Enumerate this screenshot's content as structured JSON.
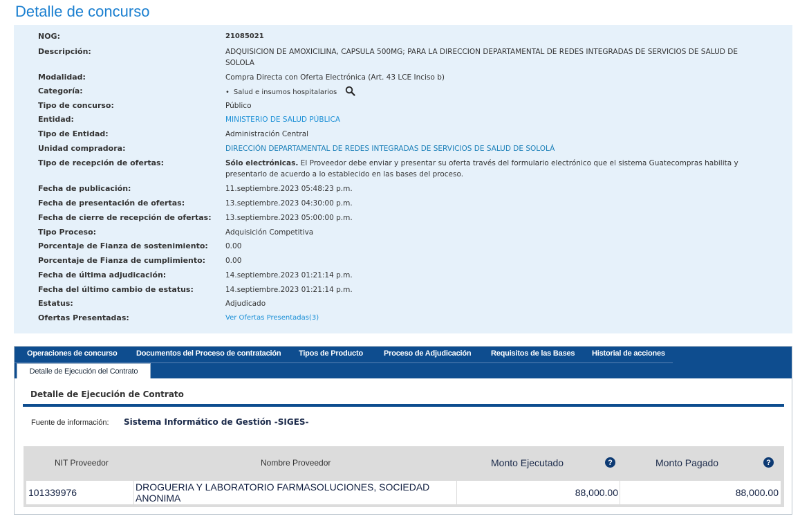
{
  "page": {
    "title": "Detalle de concurso"
  },
  "details": {
    "nog": {
      "label": "NOG:",
      "value": "21085021"
    },
    "descripcion": {
      "label": "Descripción:",
      "value": "ADQUISICION DE AMOXICILINA, CAPSULA 500MG; PARA LA DIRECCION DEPARTAMENTAL DE REDES INTEGRADAS DE SERVICIOS DE SALUD DE SOLOLA"
    },
    "modalidad": {
      "label": "Modalidad:",
      "value": "Compra Directa con Oferta Electrónica (Art. 43 LCE Inciso b)"
    },
    "categoria": {
      "label": "Categoría:",
      "bullet": "•",
      "value": "Salud e insumos hospitalarios",
      "icon": "search-icon"
    },
    "tipo_concurso": {
      "label": "Tipo de concurso:",
      "value": "Público"
    },
    "entidad": {
      "label": "Entidad:",
      "value": "MINISTERIO DE SALUD PÚBLICA"
    },
    "tipo_entidad": {
      "label": "Tipo de Entidad:",
      "value": "Administración Central"
    },
    "unidad_compradora": {
      "label": "Unidad compradora:",
      "value": "DIRECCIÓN DEPARTAMENTAL DE REDES INTEGRADAS DE SERVICIOS DE SALUD DE SOLOLÁ"
    },
    "tipo_recepcion": {
      "label": "Tipo de recepción de ofertas:",
      "strong": "Sólo electrónicas.",
      "value": " El Proveedor debe enviar y presentar su oferta través del formulario electrónico que el sistema Guatecompras habilita y presentarlo de acuerdo a lo establecido en las bases del proceso."
    },
    "fecha_publicacion": {
      "label": "Fecha de publicación:",
      "value": "11.septiembre.2023 05:48:23 p.m."
    },
    "fecha_presentacion": {
      "label": "Fecha de presentación de ofertas:",
      "value": "13.septiembre.2023 04:30:00 p.m."
    },
    "fecha_cierre": {
      "label": "Fecha de cierre de recepción de ofertas:",
      "value": "13.septiembre.2023 05:00:00 p.m."
    },
    "tipo_proceso": {
      "label": "Tipo Proceso:",
      "value": "Adquisición Competitiva"
    },
    "fianza_sostenimiento": {
      "label": "Porcentaje de Fianza de sostenimiento:",
      "value": "0.00"
    },
    "fianza_cumplimiento": {
      "label": "Porcentaje de Fianza de cumplimiento:",
      "value": "0.00"
    },
    "fecha_adjudicacion": {
      "label": "Fecha de última adjudicación:",
      "value": "14.septiembre.2023 01:21:14 p.m."
    },
    "fecha_cambio_estatus": {
      "label": "Fecha del último cambio de estatus:",
      "value": "14.septiembre.2023 01:21:14 p.m."
    },
    "estatus": {
      "label": "Estatus:",
      "value": "Adjudicado"
    },
    "ofertas": {
      "label": "Ofertas Presentadas:",
      "value": "Ver Ofertas Presentadas(3)"
    }
  },
  "tabs": [
    {
      "label": "Operaciones de concurso"
    },
    {
      "label": "Documentos del Proceso de contratación"
    },
    {
      "label": "Tipos de Producto"
    },
    {
      "label": "Proceso de Adjudicación"
    },
    {
      "label": "Requisitos de las Bases"
    },
    {
      "label": "Historial de acciones"
    }
  ],
  "active_tab": {
    "label": "Detalle de Ejecución del Contrato"
  },
  "contract": {
    "section_title": "Detalle de Ejecución de Contrato",
    "source_label": "Fuente de información:",
    "source_value": "Sistema Informático de Gestión -SIGES-",
    "columns": {
      "nit": "NIT Proveedor",
      "nombre": "Nombre Proveedor",
      "ejecutado": "Monto Ejecutado",
      "pagado": "Monto Pagado"
    },
    "help_icon_glyph": "?",
    "rows": [
      {
        "nit": "101339976",
        "nombre": "DROGUERIA Y LABORATORIO FARMASOLUCIONES, SOCIEDAD ANONIMA",
        "ejecutado": "88,000.00",
        "pagado": "88,000.00"
      }
    ]
  }
}
